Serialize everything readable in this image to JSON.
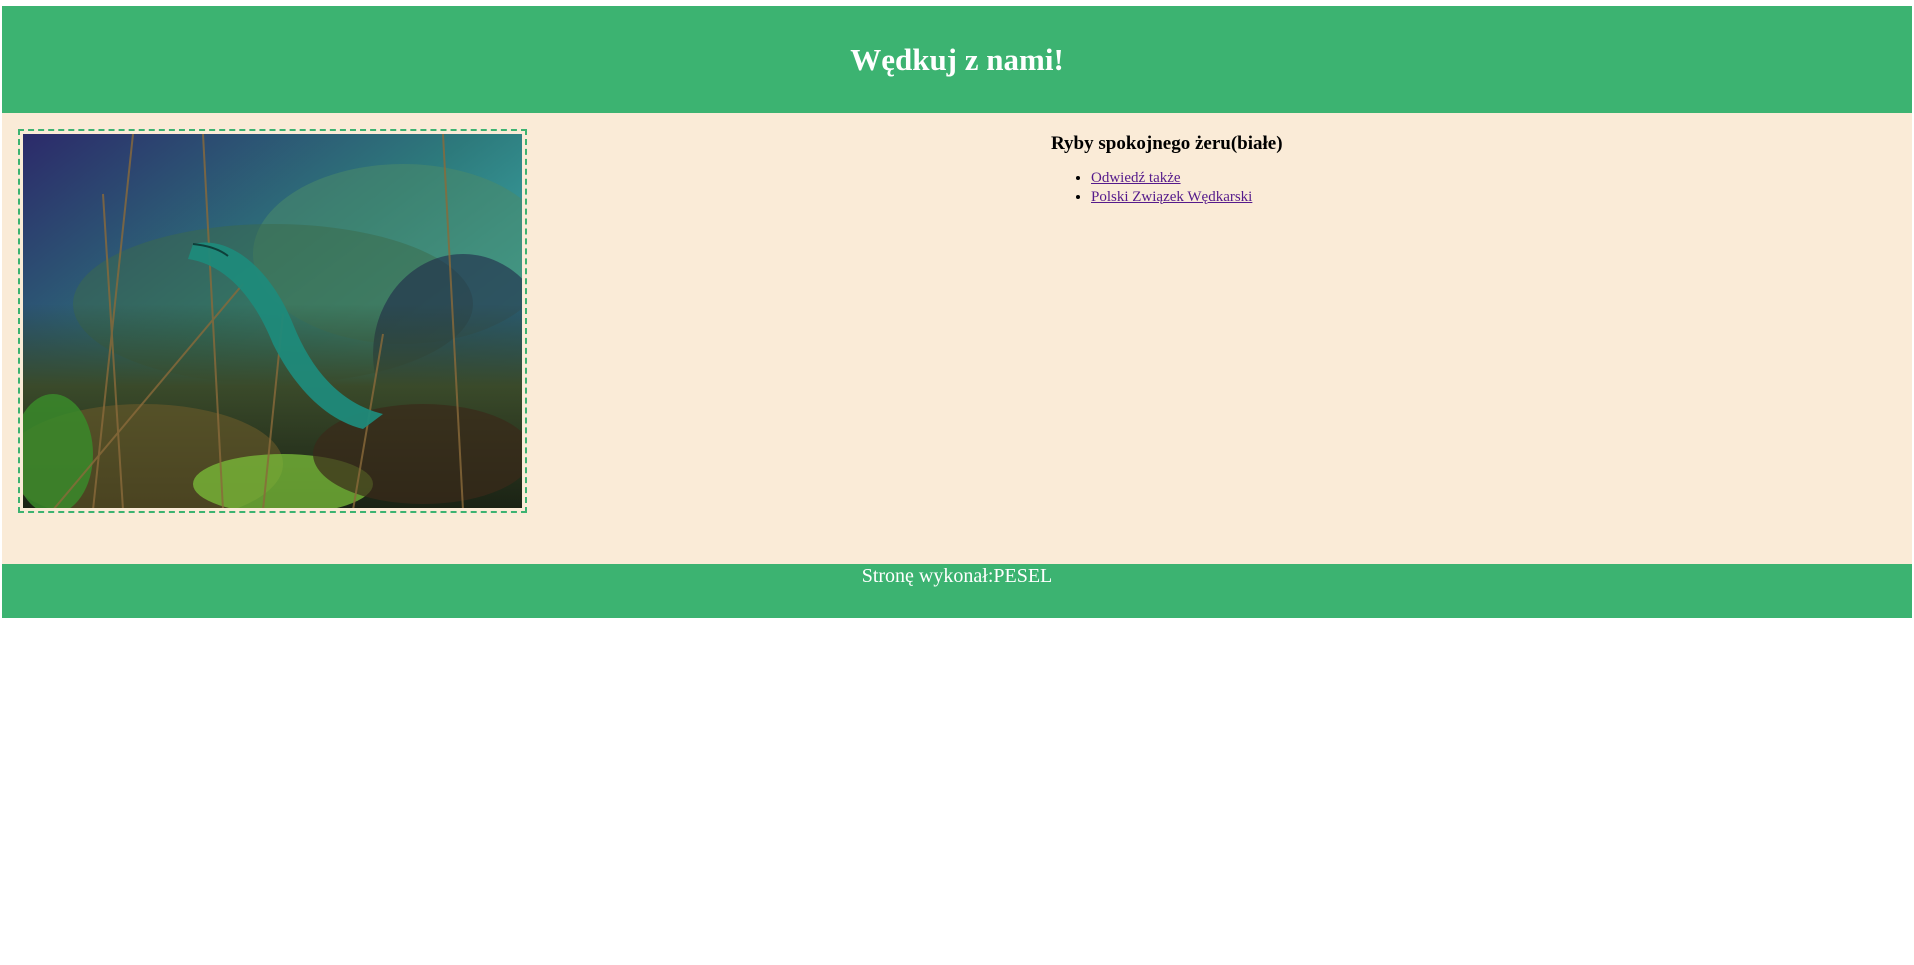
{
  "header": {
    "title": "Wędkuj z nami!"
  },
  "content": {
    "image": {
      "alt": "underwater-fish-photo"
    },
    "heading": "Ryby spokojnego żeru(białe)",
    "links": [
      {
        "label": "Odwiedź także"
      },
      {
        "label": "Polski Związek Wędkarski"
      }
    ]
  },
  "footer": {
    "text": "Stronę wykonał:PESEL"
  },
  "colors": {
    "green": "#3cb371",
    "cream": "#faebd7",
    "link": "#551a8b"
  }
}
